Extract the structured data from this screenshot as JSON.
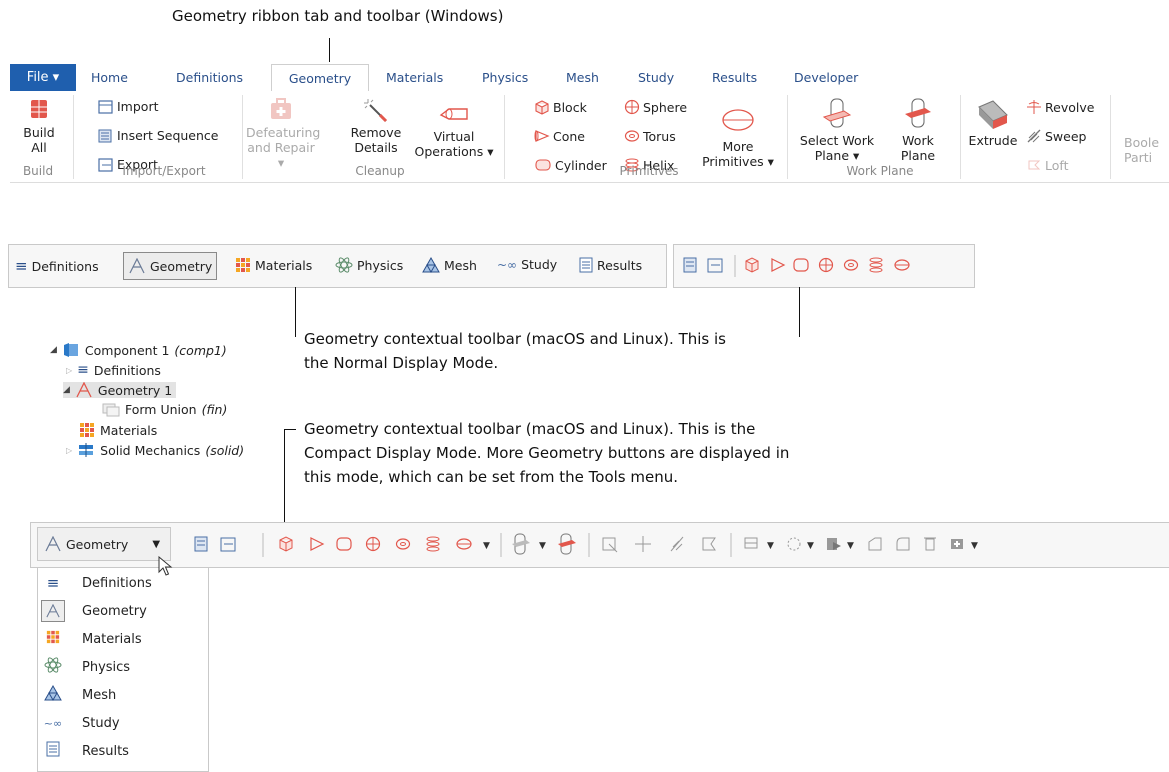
{
  "captions": {
    "ribbon": "Geometry ribbon tab and toolbar (Windows)",
    "normal_line1": "Geometry contextual toolbar (macOS and Linux). This is",
    "normal_line2": "the Normal Display Mode.",
    "compact_line1": "Geometry contextual toolbar (macOS and Linux). This is the",
    "compact_line2": "Compact Display Mode. More Geometry buttons are displayed in",
    "compact_line3": "this mode, which can be set from the Tools menu."
  },
  "ribbon": {
    "tabs": {
      "file": "File ▾",
      "home": "Home",
      "definitions": "Definitions",
      "geometry": "Geometry",
      "materials": "Materials",
      "physics": "Physics",
      "mesh": "Mesh",
      "study": "Study",
      "results": "Results",
      "developer": "Developer"
    },
    "build_all_1": "Build",
    "build_all_2": "All",
    "import": "Import",
    "insert_sequence": "Insert Sequence",
    "export": "Export",
    "defeaturing_1": "Defeaturing",
    "defeaturing_2": "and Repair ▾",
    "remove_details_1": "Remove",
    "remove_details_2": "Details",
    "virtual_ops_1": "Virtual",
    "virtual_ops_2": "Operations ▾",
    "block": "Block",
    "cone": "Cone",
    "cylinder": "Cylinder",
    "sphere": "Sphere",
    "torus": "Torus",
    "helix": "Helix",
    "more_prims_1": "More",
    "more_prims_2": "Primitives ▾",
    "select_wp_1": "Select Work",
    "select_wp_2": "Plane ▾",
    "wp_1": "Work",
    "wp_2": "Plane",
    "extrude": "Extrude",
    "revolve": "Revolve",
    "sweep": "Sweep",
    "loft": "Loft",
    "boolean_1": "Boole",
    "boolean_2": "Parti",
    "groups": {
      "build": "Build",
      "import_export": "Import/Export",
      "cleanup": "Cleanup",
      "primitives": "Primitives",
      "work_plane": "Work Plane"
    }
  },
  "normal_toolbar": {
    "definitions": "Definitions",
    "geometry": "Geometry",
    "materials": "Materials",
    "physics": "Physics",
    "mesh": "Mesh",
    "study": "Study",
    "results": "Results"
  },
  "tree": {
    "component": "Component 1",
    "component_tag": "(comp1)",
    "definitions": "Definitions",
    "geometry": "Geometry 1",
    "form_union": "Form Union",
    "form_union_tag": "(fin)",
    "materials": "Materials",
    "solid": "Solid Mechanics",
    "solid_tag": "(solid)"
  },
  "compact_toolbar": {
    "selector": "Geometry"
  },
  "menu": {
    "items": [
      "Definitions",
      "Geometry",
      "Materials",
      "Physics",
      "Mesh",
      "Study",
      "Results"
    ]
  },
  "colors": {
    "accent": "#e2574c",
    "file_tab": "#1f5fae",
    "tab_text": "#2a4f8a"
  }
}
